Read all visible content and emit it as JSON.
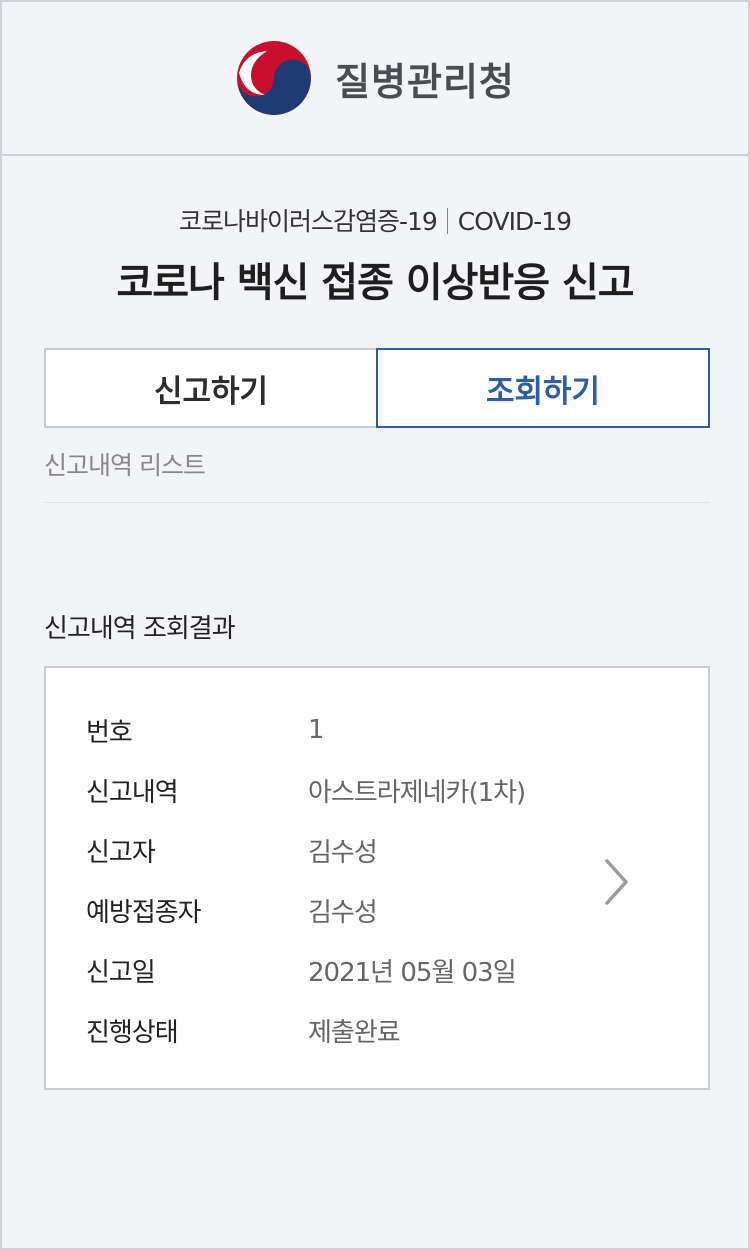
{
  "header": {
    "org_name": "질병관리청"
  },
  "page": {
    "subtitle_ko": "코로나바이러스감염증-19",
    "subtitle_en": "COVID-19",
    "title": "코로나 백신 접종 이상반응 신고"
  },
  "tabs": [
    {
      "label": "신고하기",
      "active": false
    },
    {
      "label": "조회하기",
      "active": true
    }
  ],
  "list_section": {
    "label": "신고내역 리스트"
  },
  "results": {
    "label": "신고내역 조회결과",
    "records": [
      {
        "fields": [
          {
            "key": "번호",
            "value": "1"
          },
          {
            "key": "신고내역",
            "value": "아스트라제네카(1차)"
          },
          {
            "key": "신고자",
            "value": "김수성"
          },
          {
            "key": "예방접종자",
            "value": "김수성"
          },
          {
            "key": "신고일",
            "value": "2021년 05월 03일"
          },
          {
            "key": "진행상태",
            "value": "제출완료"
          }
        ]
      }
    ]
  },
  "colors": {
    "background": "#f3f4f7",
    "accent": "#2c5ea1",
    "logo_red": "#c8102e",
    "logo_blue": "#1f3b76"
  },
  "icons": {
    "logo": "taegeuk-logo",
    "detail": "chevron-right-icon"
  }
}
